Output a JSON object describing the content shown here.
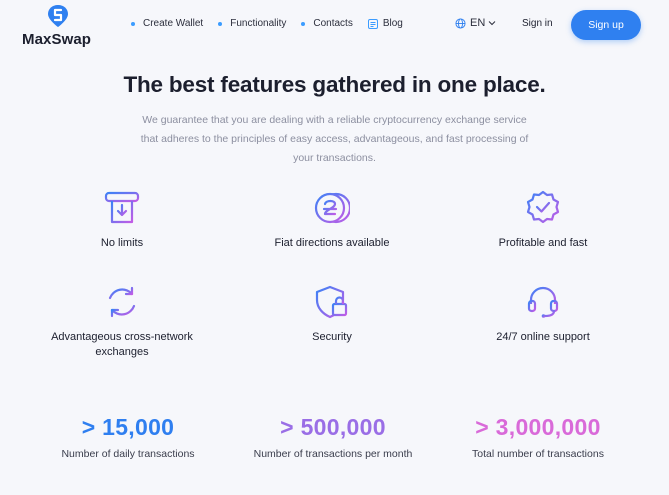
{
  "brand": {
    "name": "MaxSwap",
    "color": "#2f80f0"
  },
  "nav": {
    "items": [
      {
        "label": "Create Wallet"
      },
      {
        "label": "Functionality"
      },
      {
        "label": "Contacts"
      },
      {
        "label": "Blog"
      }
    ],
    "language": "EN",
    "sign_in": "Sign in",
    "sign_up": "Sign up"
  },
  "hero": {
    "title": "The best features gathered in one place.",
    "subtitle": "We guarantee that you are dealing with a reliable cryptocurrency exchange service that adheres to the principles of easy access, advantageous, and fast processing of your transactions."
  },
  "features": [
    {
      "label": "No limits",
      "icon": "receipt-arrow-icon"
    },
    {
      "label": "Fiat directions available",
      "icon": "coin-stack-icon"
    },
    {
      "label": "Profitable and fast",
      "icon": "verified-badge-icon"
    },
    {
      "label": "Advantageous cross-network exchanges",
      "icon": "circular-arrows-icon"
    },
    {
      "label": "Security",
      "icon": "shield-lock-icon"
    },
    {
      "label": "24/7 online support",
      "icon": "headset-icon"
    }
  ],
  "stats": [
    {
      "value": "> 15,000",
      "label": "Number of daily transactions",
      "color": "#2f7ff0"
    },
    {
      "value": "> 500,000",
      "label": "Number of transactions per month",
      "color": "#9a6ee6"
    },
    {
      "value": "> 3,000,000",
      "label": "Total number of transactions",
      "color": "#d96ad9"
    }
  ],
  "colors": {
    "icon_gradient_start": "#3b82f6",
    "icon_gradient_end": "#c25ce6",
    "subtitle": "#8c8fa0"
  }
}
